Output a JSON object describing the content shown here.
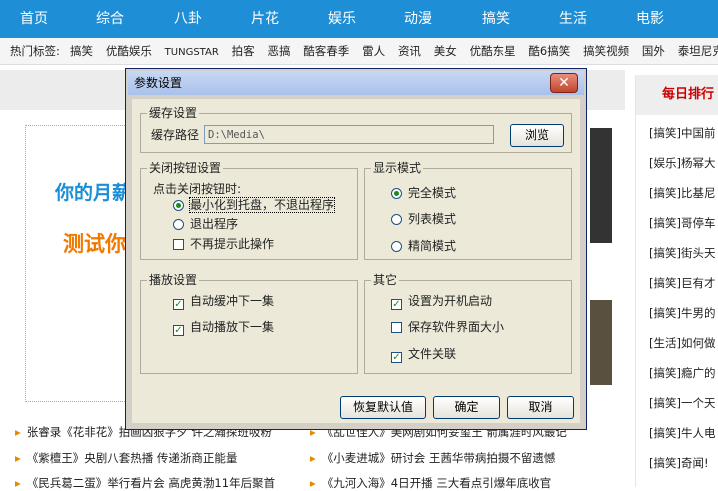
{
  "nav": [
    "首页",
    "综合",
    "八卦",
    "片花",
    "娱乐",
    "动漫",
    "搞笑",
    "生活",
    "电影"
  ],
  "tagbar": {
    "label": "热门标签:",
    "tags": [
      "搞笑",
      "优酷娱乐",
      "TUNGSTAR",
      "拍客",
      "恶搞",
      "酷客春季",
      "雷人",
      "资讯",
      "美女",
      "优酷东星",
      "酷6搞笑",
      "搞笑视频",
      "国外",
      "泰坦尼克"
    ]
  },
  "right_panel": {
    "title": "每日排行",
    "items": [
      "[搞笑]中国前",
      "[娱乐]杨幂大",
      "[搞笑]比基尼",
      "[搞笑]哥停车",
      "[搞笑]街头天",
      "[搞笑]巨有才",
      "[搞笑]牛男的",
      "[生活]如何做",
      "[搞笑]瘾广的",
      "[搞笑]一个天",
      "[搞笑]牛人电",
      "[搞笑]奇闻!"
    ]
  },
  "ad": {
    "line1": "你的月薪",
    "line2": "测试你"
  },
  "news": [
    "张睿录《花非花》拍画凶狠字夕 许之瀚探班吸粉",
    "《紫檀王》央剧八套热播 传递浙商正能量",
    "《民兵葛二蛋》举行看片会 高虎黄渤11年后聚首"
  ],
  "news_right": [
    "《乱世佳人》美网剧如何妥玺王 箭属涯时风最记",
    "《小麦进城》研讨会 王茜华带病拍摄不留遗憾",
    "《九河入海》4日开播 三大看点引爆年底收官"
  ],
  "dialog": {
    "title": "参数设置",
    "close_label": "✕",
    "cache": {
      "group_title": "缓存设置",
      "path_label": "缓存路径",
      "path_value": "D:\\Media\\",
      "browse_label": "浏览"
    },
    "close_button_settings": {
      "group_title": "关闭按钮设置",
      "prompt": "点击关闭按钮时:",
      "options": [
        {
          "label": "最小化到托盘，不退出程序",
          "checked": true
        },
        {
          "label": "退出程序",
          "checked": false
        }
      ],
      "dont_ask_label": "不再提示此操作",
      "dont_ask_checked": false
    },
    "display_mode": {
      "group_title": "显示模式",
      "options": [
        {
          "label": "完全模式",
          "checked": true
        },
        {
          "label": "列表模式",
          "checked": false
        },
        {
          "label": "精简模式",
          "checked": false
        }
      ]
    },
    "playback": {
      "group_title": "播放设置",
      "options": [
        {
          "label": "自动缓冲下一集",
          "checked": true
        },
        {
          "label": "自动播放下一集",
          "checked": true
        }
      ]
    },
    "other": {
      "group_title": "其它",
      "options": [
        {
          "label": "设置为开机启动",
          "checked": true
        },
        {
          "label": "保存软件界面大小",
          "checked": false
        },
        {
          "label": "文件关联",
          "checked": true
        }
      ]
    },
    "buttons": {
      "restore": "恢复默认值",
      "ok": "确定",
      "cancel": "取消"
    }
  }
}
